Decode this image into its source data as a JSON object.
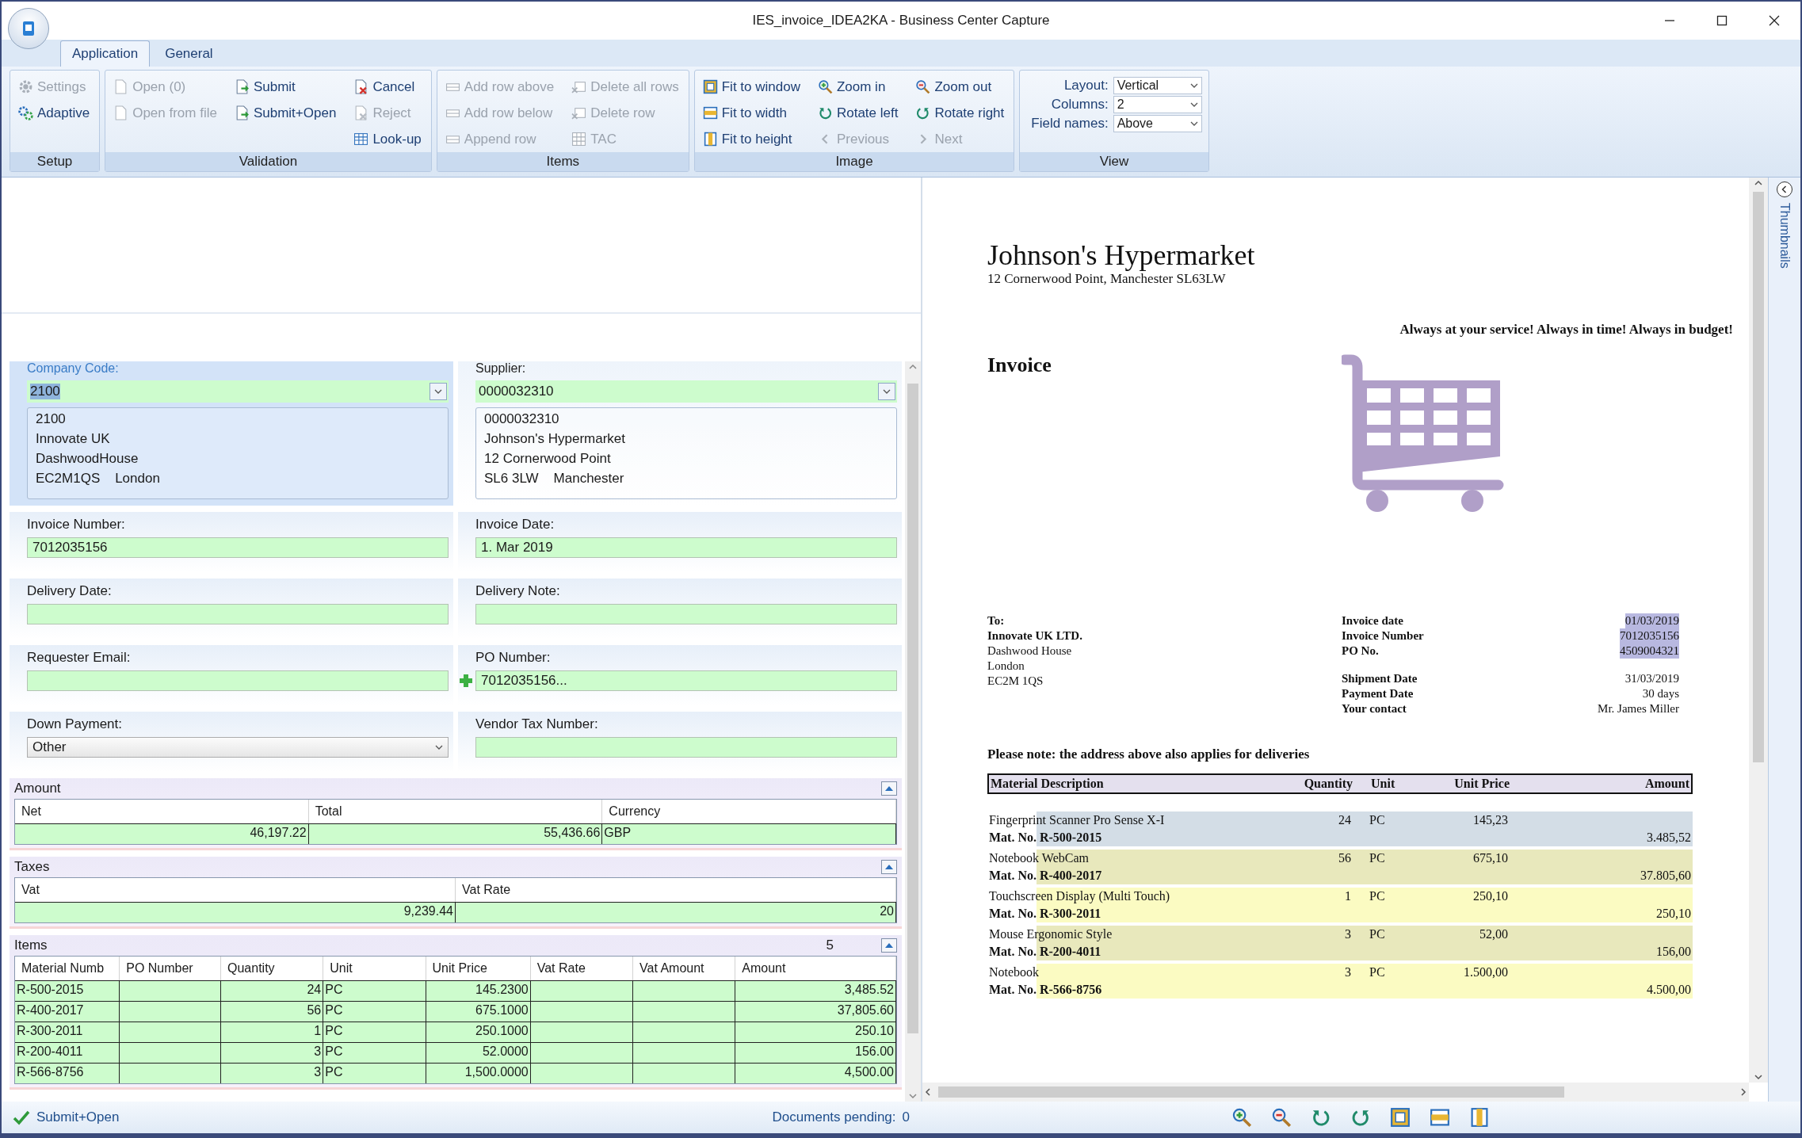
{
  "window": {
    "title": "IES_invoice_IDEA2KA - Business Center Capture"
  },
  "tabs": [
    {
      "label": "Application",
      "selected": true
    },
    {
      "label": "General",
      "selected": false
    }
  ],
  "ribbon": {
    "groups": [
      {
        "label": "Setup",
        "columns": [
          [
            {
              "label": "Settings",
              "kind": "gear",
              "disabled": true
            },
            {
              "label": "Adaptive",
              "kind": "gears",
              "disabled": false
            }
          ]
        ]
      },
      {
        "label": "Validation",
        "columns": [
          [
            {
              "label": "Open (0)",
              "kind": "document",
              "disabled": true
            },
            {
              "label": "Open from file",
              "kind": "document",
              "disabled": true
            }
          ],
          [
            {
              "label": "Submit",
              "kind": "doc-arrow",
              "disabled": false
            },
            {
              "label": "Submit+Open",
              "kind": "doc-arrow",
              "disabled": false
            }
          ],
          [
            {
              "label": "Cancel",
              "kind": "doc-cross",
              "disabled": false
            },
            {
              "label": "Reject",
              "kind": "doc-cross",
              "disabled": true
            },
            {
              "label": "Look-up",
              "kind": "table",
              "disabled": false
            }
          ]
        ]
      },
      {
        "label": "Items",
        "columns": [
          [
            {
              "label": "Add row above",
              "kind": "row",
              "disabled": true
            },
            {
              "label": "Add row below",
              "kind": "row",
              "disabled": true
            },
            {
              "label": "Append row",
              "kind": "row",
              "disabled": true
            }
          ],
          [
            {
              "label": "Delete all rows",
              "kind": "row-cross",
              "disabled": true
            },
            {
              "label": "Delete row",
              "kind": "row-cross",
              "disabled": true
            },
            {
              "label": "TAC",
              "kind": "grid",
              "disabled": true
            }
          ]
        ]
      },
      {
        "label": "Image",
        "columns": [
          [
            {
              "label": "Fit to window",
              "kind": "frame",
              "disabled": false
            },
            {
              "label": "Fit to width",
              "kind": "hbar",
              "disabled": false
            },
            {
              "label": "Fit to height",
              "kind": "vbar",
              "disabled": false
            }
          ],
          [
            {
              "label": "Zoom in",
              "kind": "zoom-in",
              "disabled": false
            },
            {
              "label": "Rotate left",
              "kind": "rot-left",
              "disabled": false
            },
            {
              "label": "Previous",
              "kind": "prev",
              "disabled": true
            }
          ],
          [
            {
              "label": "Zoom out",
              "kind": "zoom-out",
              "disabled": false
            },
            {
              "label": "Rotate right",
              "kind": "rot-right",
              "disabled": false
            },
            {
              "label": "Next",
              "kind": "next",
              "disabled": true
            }
          ]
        ]
      }
    ],
    "view": {
      "label": "View",
      "fields": [
        {
          "label": "Layout:",
          "value": "Vertical"
        },
        {
          "label": "Columns:",
          "value": "2"
        },
        {
          "label": "Field names:",
          "value": "Above"
        }
      ]
    }
  },
  "form": {
    "parties": [
      {
        "label": "Company Code:",
        "value": "2100",
        "focused": true,
        "lines": [
          "2100",
          "Innovate UK",
          "DashwoodHouse",
          "EC2M1QS    London"
        ]
      },
      {
        "label": "Supplier:",
        "value": "0000032310",
        "focused": false,
        "lines": [
          "0000032310",
          "Johnson's Hypermarket",
          "12 Cornerwood Point",
          "SL6 3LW    Manchester"
        ]
      }
    ],
    "fields": [
      {
        "label": "Invoice Number:",
        "value": "7012035156",
        "kind": "text"
      },
      {
        "label": "Invoice Date:",
        "value": "1. Mar 2019",
        "kind": "text"
      },
      {
        "label": "Delivery Date:",
        "kind": "text"
      },
      {
        "label": "Delivery Note:",
        "kind": "text"
      },
      {
        "label": "Requester Email:",
        "kind": "text"
      },
      {
        "label": "PO Number:",
        "value": "7012035156...",
        "kind": "lookup"
      },
      {
        "label": "Down Payment:",
        "value": "Other",
        "kind": "dropdown"
      },
      {
        "label": "Vendor Tax Number:",
        "kind": "text"
      }
    ],
    "amount": {
      "title": "Amount",
      "columns": [
        {
          "label": "Net",
          "kind": "number"
        },
        {
          "label": "Total",
          "kind": "number"
        },
        {
          "label": "Currency",
          "kind": "text"
        }
      ],
      "rows": [
        [
          "46,197.22",
          "55,436.66",
          "GBP"
        ]
      ]
    },
    "taxes": {
      "title": "Taxes",
      "columns": [
        {
          "label": "Vat",
          "kind": "number"
        },
        {
          "label": "Vat Rate",
          "kind": "number"
        }
      ],
      "rows": [
        [
          "9,239.44",
          "20"
        ]
      ]
    },
    "items": {
      "title": "Items",
      "count": "5",
      "columns": [
        {
          "label": "Material Numb",
          "kind": "text"
        },
        {
          "label": "PO Number",
          "kind": "text"
        },
        {
          "label": "Quantity",
          "kind": "number"
        },
        {
          "label": "Unit",
          "kind": "text"
        },
        {
          "label": "Unit Price",
          "kind": "number"
        },
        {
          "label": "Vat Rate",
          "kind": "number"
        },
        {
          "label": "Vat Amount",
          "kind": "number"
        },
        {
          "label": "Amount",
          "kind": "number"
        }
      ],
      "rows": [
        [
          "R-500-2015",
          "",
          "24",
          "PC",
          "145.2300",
          "",
          "",
          "3,485.52"
        ],
        [
          "R-400-2017",
          "",
          "56",
          "PC",
          "675.1000",
          "",
          "",
          "37,805.60"
        ],
        [
          "R-300-2011",
          "",
          "1",
          "PC",
          "250.1000",
          "",
          "",
          "250.10"
        ],
        [
          "R-200-4011",
          "",
          "3",
          "PC",
          "52.0000",
          "",
          "",
          "156.00"
        ],
        [
          "R-566-8756",
          "",
          "3",
          "PC",
          "1,500.0000",
          "",
          "",
          "4,500.00"
        ]
      ]
    }
  },
  "status": {
    "action": "Submit+Open",
    "pending_label": "Documents pending:",
    "pending": "0"
  },
  "thumbnails": {
    "label": "Thumbnails"
  },
  "document": {
    "company": "Johnson's Hypermarket",
    "address": "12 Cornerwood Point, Manchester SL63LW",
    "slogan": "Always at your service! Always in time! Always in budget!",
    "heading": "Invoice",
    "to": {
      "label": "To:",
      "name": "Innovate UK LTD.",
      "lines": [
        "Dashwood House",
        "London",
        "EC2M 1QS"
      ]
    },
    "meta": [
      [
        {
          "label": "Invoice date",
          "value": "01/03/2019",
          "highlighted": true
        },
        {
          "label": "Invoice Number",
          "value": "7012035156",
          "highlighted": true
        },
        {
          "label": "PO No.",
          "value": "4509004321",
          "highlighted": true
        }
      ],
      [
        {
          "label": "Shipment Date",
          "value": "31/03/2019",
          "highlighted": false
        },
        {
          "label": "Payment Date",
          "value": "30 days",
          "highlighted": false
        },
        {
          "label": "Your contact",
          "value": "Mr. James Miller",
          "highlighted": false
        }
      ]
    ],
    "note": "Please note: the address above also applies for deliveries",
    "columns": [
      "Material Description",
      "Quantity",
      "Unit",
      "Unit Price",
      "Amount"
    ],
    "items": [
      {
        "description": "Fingerprint Scanner Pro Sense X-I",
        "quantity": "24",
        "unit": "PC",
        "price": "145,23",
        "material": "Mat. No. R-500-2015",
        "amount": "3.485,52",
        "color": "#d3dde6"
      },
      {
        "description": "Notebook WebCam",
        "quantity": "56",
        "unit": "PC",
        "price": "675,10",
        "material": "Mat. No. R-400-2017",
        "amount": "37.805,60",
        "color": "#e8e8bc"
      },
      {
        "description": "Touchscreen Display (Multi Touch)",
        "quantity": "1",
        "unit": "PC",
        "price": "250,10",
        "material": "Mat. No. R-300-2011",
        "amount": "250,10",
        "color": "#fbfbc2"
      },
      {
        "description": "Mouse Ergonomic Style",
        "quantity": "3",
        "unit": "PC",
        "price": "52,00",
        "material": "Mat. No. R-200-4011",
        "amount": "156,00",
        "color": "#e8e8bc"
      },
      {
        "description": "Notebook",
        "quantity": "3",
        "unit": "PC",
        "price": "1.500,00",
        "material": "Mat. No. R-566-8756",
        "amount": "4.500,00",
        "color": "#fbfbc2"
      }
    ]
  }
}
